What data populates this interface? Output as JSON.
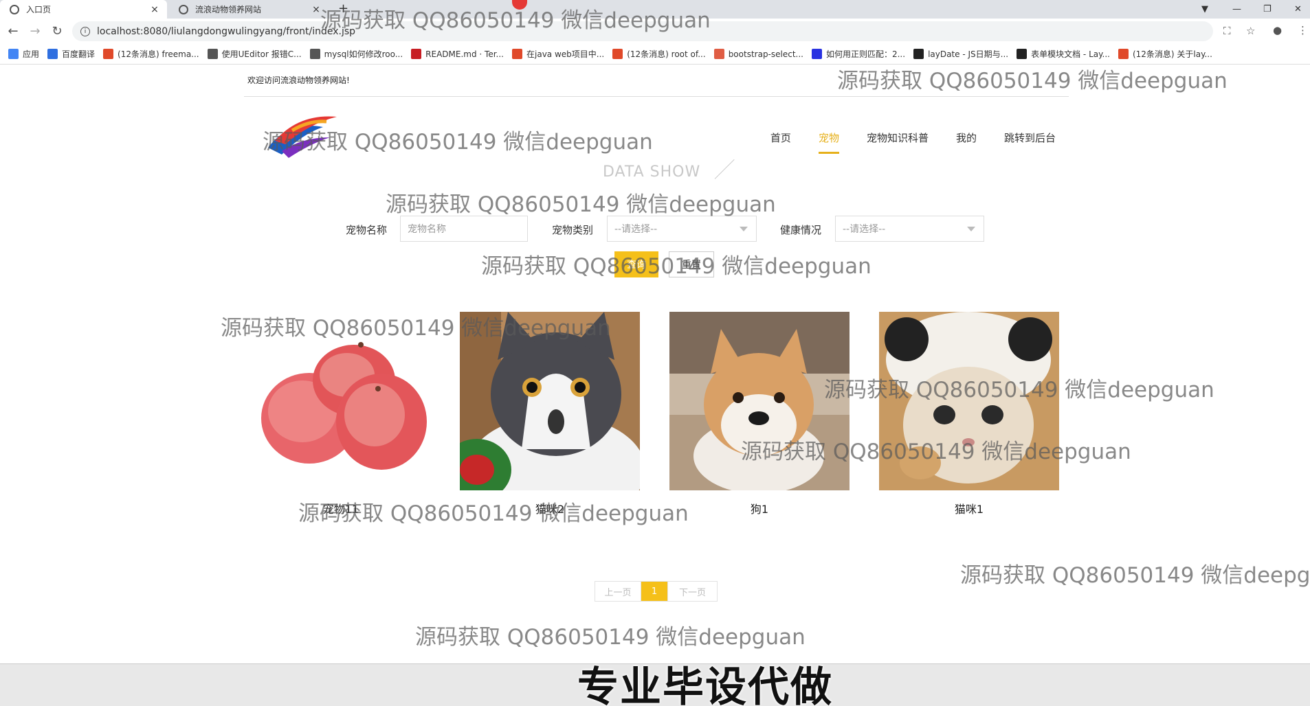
{
  "browser": {
    "tabs": [
      {
        "title": "入口页",
        "active": true
      },
      {
        "title": "流浪动物领养网站",
        "active": false
      }
    ],
    "url": "localhost:8080/liulangdongwulingyang/front/index.jsp",
    "bookmarks": [
      {
        "label": "应用",
        "icon": "apps-icon"
      },
      {
        "label": "百度翻译",
        "icon": "baidu-translate-icon"
      },
      {
        "label": "(12条消息) freema...",
        "icon": "csdn-icon"
      },
      {
        "label": "使用UEditor 报错C...",
        "icon": "ueditor-icon"
      },
      {
        "label": "mysql如何修改roo...",
        "icon": "ueditor-icon"
      },
      {
        "label": "README.md · Ter...",
        "icon": "gitee-icon"
      },
      {
        "label": "在java web项目中...",
        "icon": "csdn-icon"
      },
      {
        "label": "(12条消息) root of...",
        "icon": "csdn-icon"
      },
      {
        "label": "bootstrap-select...",
        "icon": "bootstrap-icon"
      },
      {
        "label": "如何用正则匹配：2...",
        "icon": "baidu-paw-icon"
      },
      {
        "label": "layDate - JS日期与...",
        "icon": "layui-icon"
      },
      {
        "label": "表单模块文档 - Lay...",
        "icon": "layui-icon"
      },
      {
        "label": "(12条消息) 关于lay...",
        "icon": "csdn-icon"
      }
    ]
  },
  "header": {
    "welcome": "欢迎访问流浪动物领养网站!",
    "nav": [
      {
        "label": "首页",
        "active": false
      },
      {
        "label": "宠物",
        "active": true
      },
      {
        "label": "宠物知识科普",
        "active": false
      },
      {
        "label": "我的",
        "active": false
      },
      {
        "label": "跳转到后台",
        "active": false
      }
    ]
  },
  "section": {
    "title": "DATA SHOW"
  },
  "search": {
    "name_label": "宠物名称",
    "name_placeholder": "宠物名称",
    "type_label": "宠物类别",
    "type_value": "--请选择--",
    "health_label": "健康情况",
    "health_value": "--请选择--",
    "search_button": "查询",
    "reset_button": "重置"
  },
  "pets": [
    {
      "name": "宠物11",
      "image": "apples"
    },
    {
      "name": "猫咪2",
      "image": "cat-surprised"
    },
    {
      "name": "狗1",
      "image": "shiba-dog"
    },
    {
      "name": "猫咪1",
      "image": "cat-panda-hat"
    }
  ],
  "pager": {
    "prev": "上一页",
    "current": "1",
    "next": "下一页"
  },
  "overlay": {
    "watermark": "源码获取 QQ86050149 微信deepguan",
    "caption": "专业毕设代做"
  },
  "colors": {
    "accent": "#f5c01a",
    "nav_active": "#e6b01b"
  }
}
